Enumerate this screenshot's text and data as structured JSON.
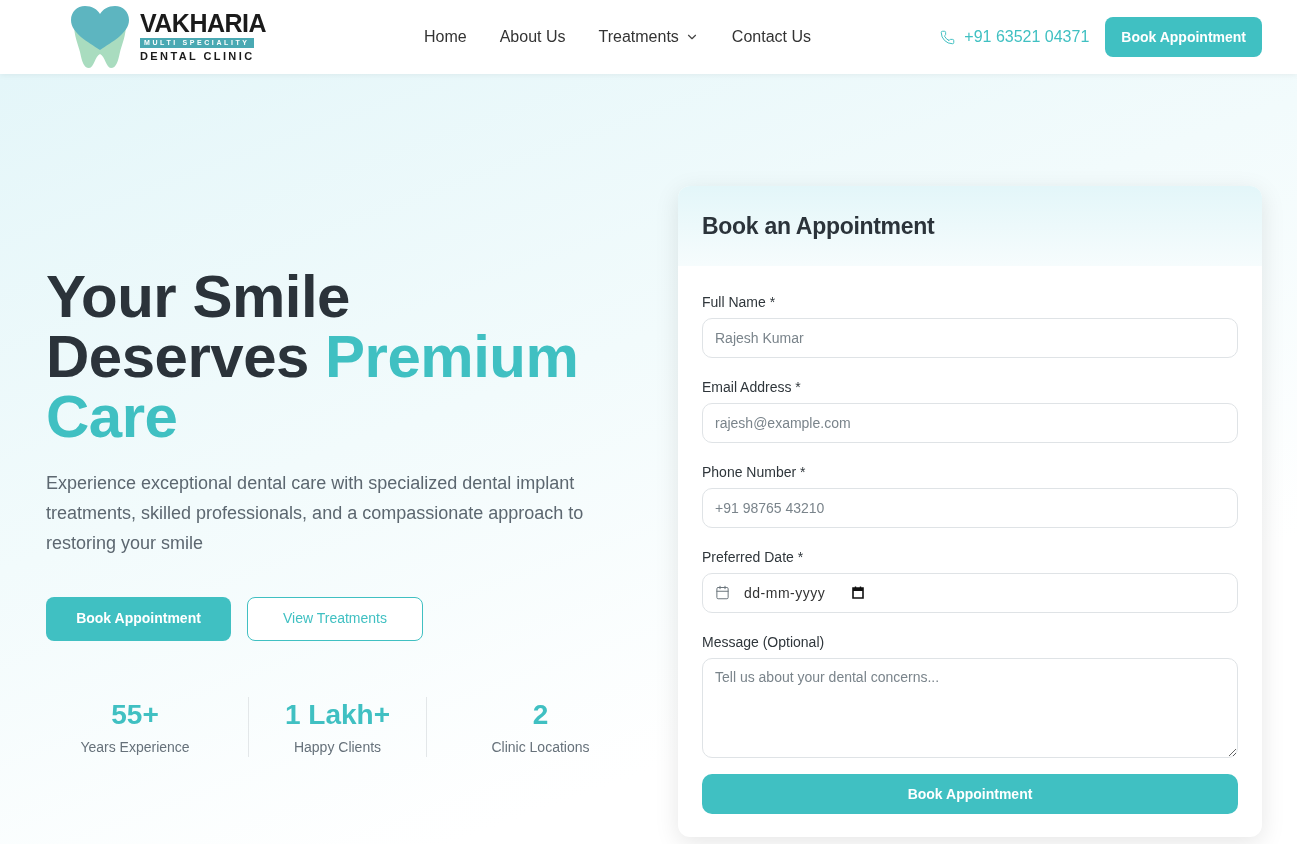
{
  "header": {
    "logo": {
      "name": "VAKHARIA",
      "tagline": "MULTI SPECIALITY",
      "subtitle": "DENTAL CLINIC"
    },
    "nav": [
      {
        "label": "Home",
        "dropdown": false
      },
      {
        "label": "About Us",
        "dropdown": false
      },
      {
        "label": "Treatments",
        "dropdown": true
      },
      {
        "label": "Contact Us",
        "dropdown": false
      }
    ],
    "phone": "+91 63521 04371",
    "cta": "Book Appointment"
  },
  "hero": {
    "heading": {
      "lead": "Your Smile Deserves",
      "highlight": "Premium Care"
    },
    "description": "Experience exceptional dental care with specialized dental implant treatments, skilled professionals, and a compassionate approach to restoring your smile",
    "buttons": [
      {
        "label": "Book Appointment",
        "kind": "primary"
      },
      {
        "label": "View Treatments",
        "kind": "outline"
      }
    ],
    "stats": [
      {
        "value": "55+",
        "label": "Years Experience"
      },
      {
        "value": "1 Lakh+",
        "label": "Happy Clients"
      },
      {
        "value": "2",
        "label": "Clinic Locations"
      }
    ]
  },
  "form": {
    "title": "Book an Appointment",
    "fields": [
      {
        "kind": "text",
        "label": "Full Name *",
        "placeholder": "Rajesh Kumar"
      },
      {
        "kind": "text",
        "label": "Email Address *",
        "placeholder": "rajesh@example.com"
      },
      {
        "kind": "text",
        "label": "Phone Number *",
        "placeholder": "+91 98765 43210"
      },
      {
        "kind": "date",
        "label": "Preferred Date *",
        "placeholder": "dd-mm-yyyy"
      },
      {
        "kind": "textarea",
        "label": "Message (Optional)",
        "placeholder": "Tell us about your dental concerns..."
      }
    ],
    "submit": "Book Appointment"
  }
}
